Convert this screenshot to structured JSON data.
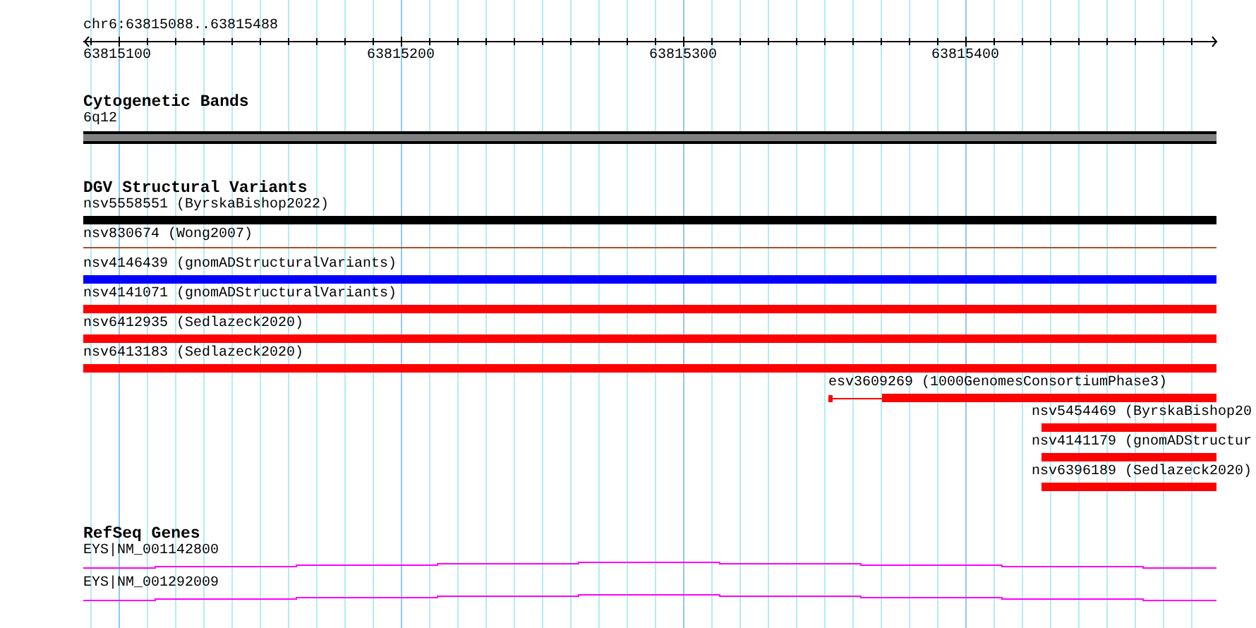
{
  "ruler": {
    "region": "chr6:63815088..63815488",
    "ticks": [
      "63815100",
      "63815200",
      "63815300",
      "63815400"
    ]
  },
  "tracks": [
    {
      "title": "Cytogenetic Bands",
      "kind": "bands",
      "features": [
        {
          "label": "6q12",
          "color": "#808080",
          "kind": "band"
        }
      ]
    },
    {
      "title": "DGV Structural Variants",
      "kind": "variants",
      "features": [
        {
          "label": "nsv5558551 (ByrskaBishop2022)",
          "color": "#000000",
          "kind": "bar"
        },
        {
          "label": "nsv830674 (Wong2007)",
          "color": "#a0522d",
          "kind": "thin"
        },
        {
          "label": "nsv4146439 (gnomADStructuralVariants)",
          "color": "#0000ff",
          "kind": "bar"
        },
        {
          "label": "nsv4141071 (gnomADStructuralVariants)",
          "color": "#ff0000",
          "kind": "bar"
        },
        {
          "label": "nsv6412935 (Sedlazeck2020)",
          "color": "#ff0000",
          "kind": "bar"
        },
        {
          "label": "nsv6413183 (Sedlazeck2020)",
          "color": "#ff0000",
          "kind": "bar"
        },
        {
          "label": "esv3609269 (1000GenomesConsortiumPhase3)",
          "color": "#ff0000",
          "kind": "split"
        },
        {
          "label": "nsv5454469 (ByrskaBishop20",
          "color": "#ff0000",
          "kind": "tail"
        },
        {
          "label": "nsv4141179 (gnomADStructur",
          "color": "#ff0000",
          "kind": "tail"
        },
        {
          "label": "nsv6396189 (Sedlazeck2020)",
          "color": "#ff0000",
          "kind": "tail"
        }
      ]
    },
    {
      "title": "RefSeq Genes",
      "kind": "genes",
      "features": [
        {
          "label": "EYS|NM_001142800",
          "color": "#ff00ff",
          "kind": "gene"
        },
        {
          "label": "EYS|NM_001292009",
          "color": "#ff00ff",
          "kind": "gene"
        }
      ]
    }
  ]
}
